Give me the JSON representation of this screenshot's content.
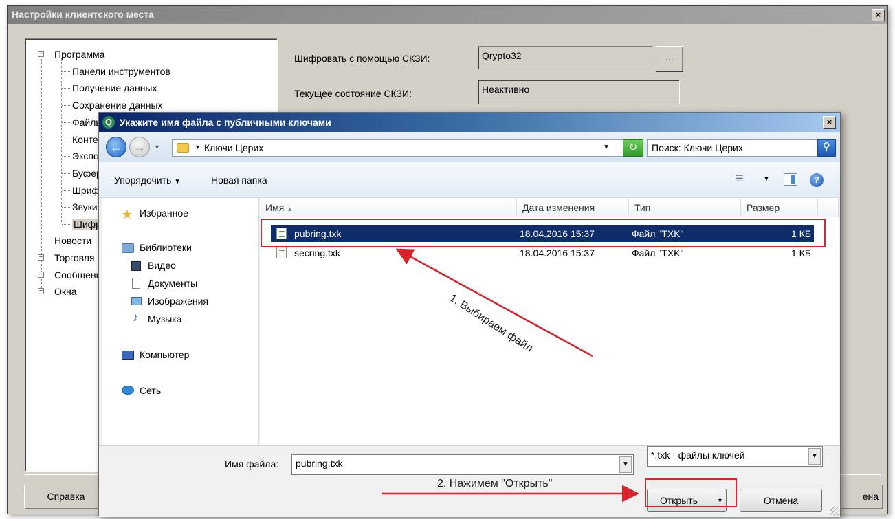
{
  "outer": {
    "title": "Настройки клиентского места",
    "close": "×",
    "tree": [
      {
        "label": "Программа",
        "level": 0,
        "exp": "−"
      },
      {
        "label": "Панели инструментов",
        "level": 1
      },
      {
        "label": "Получение данных",
        "level": 1
      },
      {
        "label": "Сохранение данных",
        "level": 1
      },
      {
        "label": "Файлы",
        "level": 1
      },
      {
        "label": "Контекст",
        "level": 1
      },
      {
        "label": "Экспорт",
        "level": 1
      },
      {
        "label": "Буфер",
        "level": 1
      },
      {
        "label": "Шрифт",
        "level": 1
      },
      {
        "label": "Звуки",
        "level": 1
      },
      {
        "label": "Шифр",
        "level": 1
      },
      {
        "label": "Новости",
        "level": 0
      },
      {
        "label": "Торговля",
        "level": 0,
        "exp": "+"
      },
      {
        "label": "Сообщения",
        "level": 0,
        "exp": "+"
      },
      {
        "label": "Окна",
        "level": 0,
        "exp": "+"
      }
    ],
    "encrypt_label": "Шифровать с помощью СКЗИ:",
    "encrypt_value": "Qrypto32",
    "browse_btn": "...",
    "state_label": "Текущее состояние СКЗИ:",
    "state_value": "Неактивно",
    "help_btn": "Справка",
    "cancel_btn_partial": "ена"
  },
  "file_dialog": {
    "icon_letter": "Q",
    "title": "Укажите имя файла с публичными ключами",
    "close": "×",
    "address": "Ключи Церих",
    "search_placeholder": "Поиск: Ключи Церих",
    "toolbar": {
      "organize": "Упорядочить",
      "new_folder": "Новая папка"
    },
    "nav": {
      "favorites": "Избранное",
      "libraries": "Библиотеки",
      "video": "Видео",
      "documents": "Документы",
      "images": "Изображения",
      "music": "Музыка",
      "computer": "Компьютер",
      "network": "Сеть"
    },
    "columns": {
      "name": "Имя",
      "date": "Дата изменения",
      "type": "Тип",
      "size": "Размер"
    },
    "files": [
      {
        "name": "pubring.txk",
        "date": "18.04.2016 15:37",
        "type": "Файл \"TXK\"",
        "size": "1 КБ",
        "selected": true
      },
      {
        "name": "secring.txk",
        "date": "18.04.2016 15:37",
        "type": "Файл \"TXK\"",
        "size": "1 КБ",
        "selected": false
      }
    ],
    "filename_label": "Имя файла:",
    "filename_value": "pubring.txk",
    "filter_value": "*.txk - файлы ключей",
    "open_btn": "Открыть",
    "cancel_btn": "Отмена"
  },
  "annotations": {
    "step1": "1. Выбираем файл",
    "step2": "2. Нажимем \"Открыть\""
  },
  "colors": {
    "highlight": "#d8232a",
    "selection": "#0f2c6b"
  }
}
